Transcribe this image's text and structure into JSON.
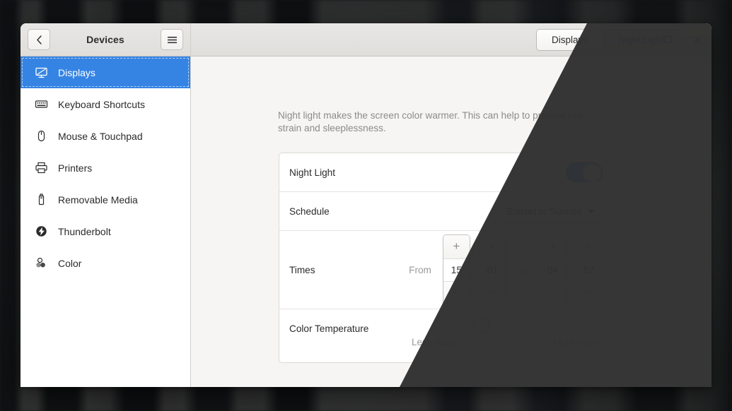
{
  "window": {
    "title": "Devices",
    "back_label": "‹",
    "menu_label": "☰",
    "back_icon": "chevron-left-icon",
    "menu_icon": "hamburger-menu-icon"
  },
  "tabs": [
    {
      "label": "Displays",
      "active": true
    },
    {
      "label": "Night Light",
      "active": false
    }
  ],
  "window_controls": [
    {
      "name": "minimize",
      "glyph": "—"
    },
    {
      "name": "maximize",
      "glyph": "□"
    },
    {
      "name": "close",
      "glyph": "✕"
    }
  ],
  "sidebar": {
    "items": [
      {
        "label": "Displays",
        "icon": "display-icon",
        "selected": true
      },
      {
        "label": "Keyboard Shortcuts",
        "icon": "keyboard-icon",
        "selected": false
      },
      {
        "label": "Mouse & Touchpad",
        "icon": "mouse-icon",
        "selected": false
      },
      {
        "label": "Printers",
        "icon": "printer-icon",
        "selected": false
      },
      {
        "label": "Removable Media",
        "icon": "usb-drive-icon",
        "selected": false
      },
      {
        "label": "Thunderbolt",
        "icon": "thunderbolt-icon",
        "selected": false
      },
      {
        "label": "Color",
        "icon": "color-profile-icon",
        "selected": false
      }
    ]
  },
  "main": {
    "description": "Night light makes the screen color warmer. This can help to prevent eye strain and sleeplessness.",
    "rows": {
      "night_light": {
        "label": "Night Light",
        "toggle_on": true
      },
      "schedule": {
        "label": "Schedule",
        "value": "Sunset to Sunrise",
        "caret_icon": "chevron-down-icon"
      },
      "times": {
        "label": "Times",
        "from_label": "From",
        "to_label": "To",
        "from_hour": "15",
        "from_minute": "01",
        "to_hour": "04",
        "to_minute": "57",
        "separator": ":",
        "increment_glyph": "+",
        "decrement_glyph": "−"
      },
      "color_temperature": {
        "label": "Color Temperature",
        "min_label": "Less Warm",
        "max_label": "More Warm",
        "value_percent": 36
      }
    }
  },
  "colors": {
    "accent": "#3584e4",
    "slider_cold": "#fad3b0",
    "slider_warm": "#e8743a",
    "night_overlay": "#303030",
    "sidebar_bg": "#ffffff",
    "main_bg": "#f6f5f4"
  }
}
